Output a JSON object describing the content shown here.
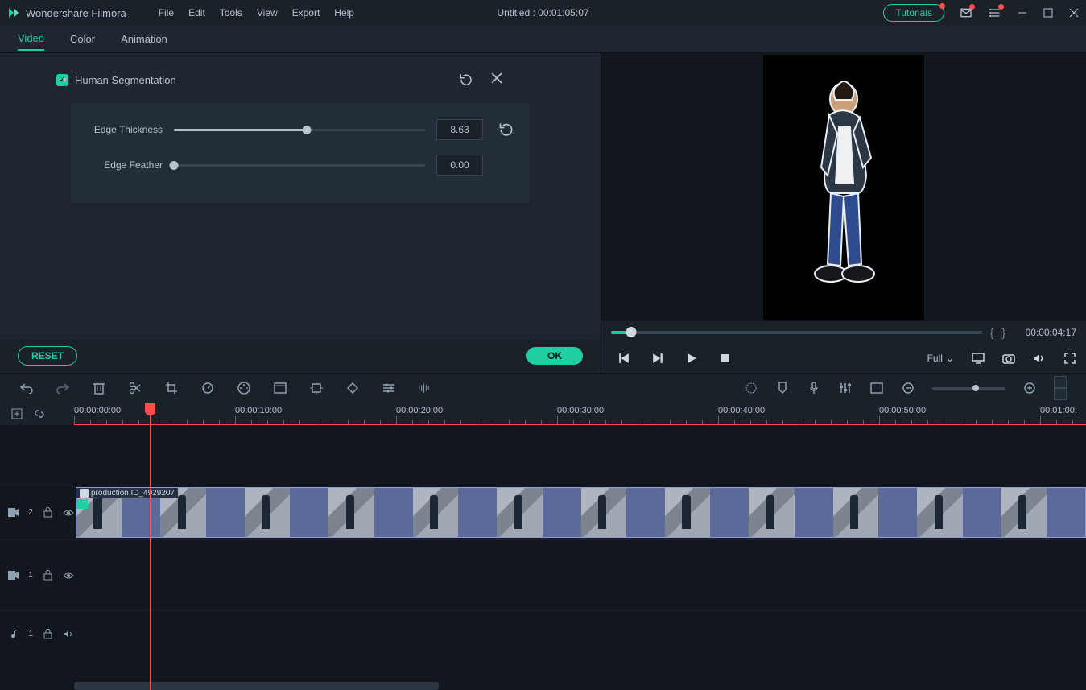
{
  "app": {
    "name": "Wondershare Filmora"
  },
  "menu": {
    "items": [
      "File",
      "Edit",
      "Tools",
      "View",
      "Export",
      "Help"
    ]
  },
  "window": {
    "title": "Untitled : 00:01:05:07",
    "tutorials": "Tutorials"
  },
  "tabs": {
    "video": "Video",
    "color": "Color",
    "animation": "Animation"
  },
  "seg": {
    "title": "Human Segmentation",
    "thickness_label": "Edge Thickness",
    "thickness_val": "8.63",
    "thickness_pct": 53,
    "feather_label": "Edge Feather",
    "feather_val": "0.00",
    "feather_pct": 0
  },
  "buttons": {
    "reset": "RESET",
    "ok": "OK"
  },
  "preview": {
    "timecode": "00:00:04:17",
    "quality": "Full"
  },
  "timeline": {
    "labels": [
      "00:00:00:00",
      "00:00:10:00",
      "00:00:20:00",
      "00:00:30:00",
      "00:00:40:00",
      "00:00:50:00",
      "00:01:00:"
    ],
    "playhead_pct": 7.5,
    "clip_name": "production ID_4929207",
    "track_v2": "2",
    "track_v1": "1",
    "track_a1": "1"
  }
}
